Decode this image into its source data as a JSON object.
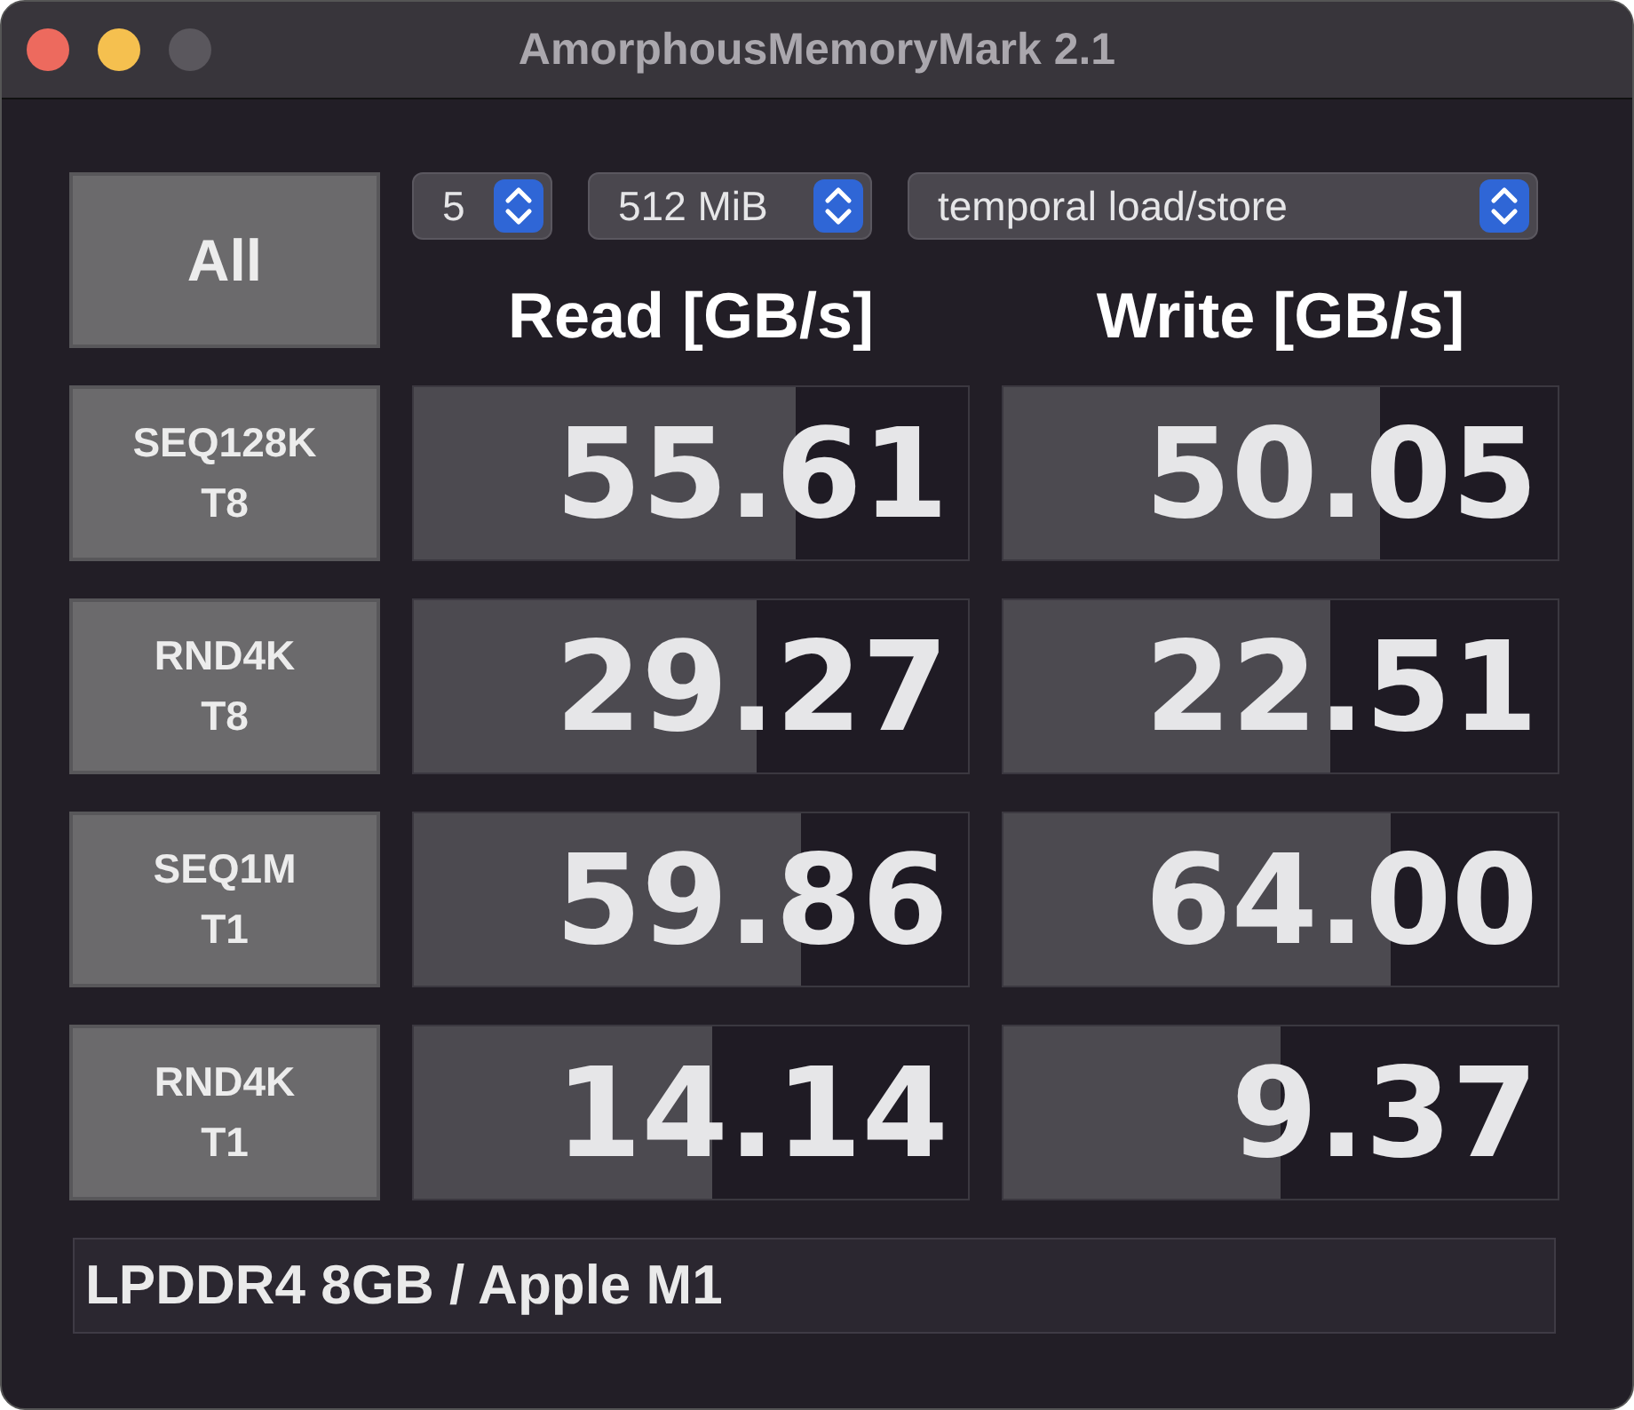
{
  "window": {
    "title": "AmorphousMemoryMark 2.1"
  },
  "all_button": {
    "label": "All"
  },
  "selectors": [
    {
      "value": "5"
    },
    {
      "value": "512 MiB"
    },
    {
      "value": "temporal load/store"
    }
  ],
  "columns": [
    "Read [GB/s]",
    "Write [GB/s]"
  ],
  "tests": [
    {
      "label": "SEQ128K\nT8",
      "read": {
        "reading": "55.61",
        "level": 0.69
      },
      "write": {
        "reading": "50.05",
        "level": 0.68
      }
    },
    {
      "label": "RND4K\nT8",
      "read": {
        "reading": "29.27",
        "level": 0.62
      },
      "write": {
        "reading": "22.51",
        "level": 0.59
      }
    },
    {
      "label": "SEQ1M\nT1",
      "read": {
        "reading": "59.86",
        "level": 0.7
      },
      "write": {
        "reading": "64.00",
        "level": 0.7
      }
    },
    {
      "label": "RND4K\nT1",
      "read": {
        "reading": "14.14",
        "level": 0.54
      },
      "write": {
        "reading": "9.37",
        "level": 0.5
      }
    }
  ],
  "info": {
    "value": "LPDDR4 8GB / Apple M1"
  }
}
